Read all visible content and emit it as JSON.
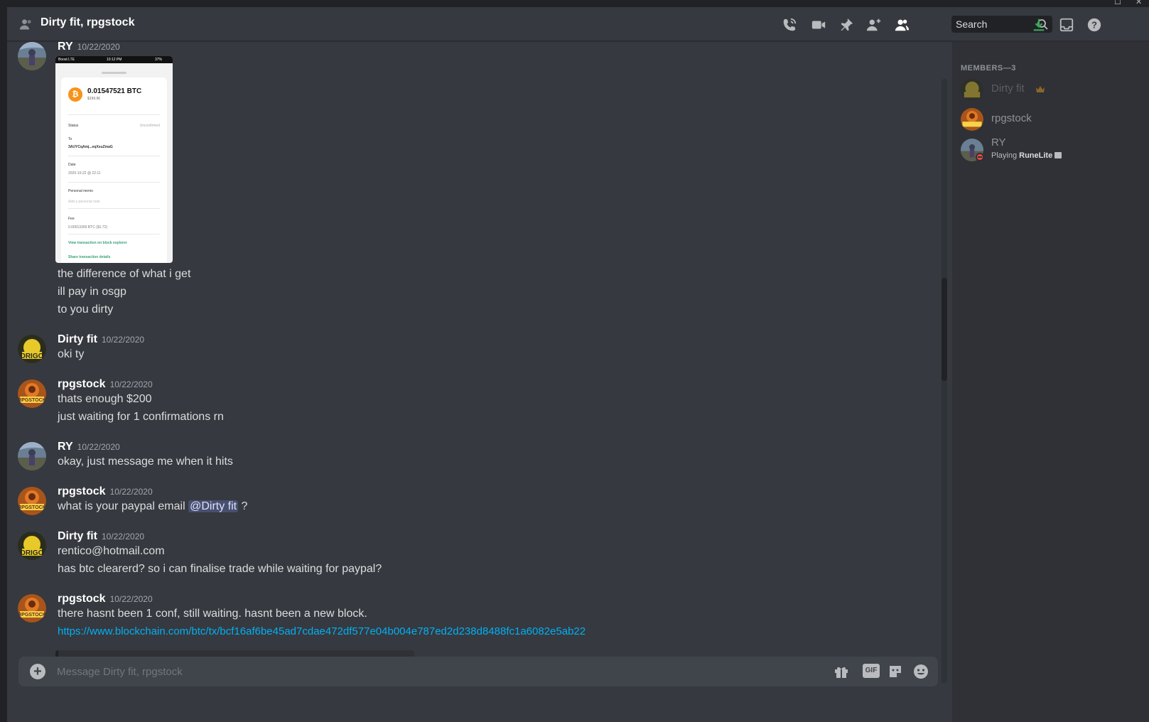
{
  "header": {
    "title": "Dirty fit, rpgstock",
    "search_placeholder": "Search"
  },
  "icons": {
    "dm": "dm-people-icon",
    "call": "phone-call-icon",
    "video": "video-camera-icon",
    "pin": "pin-icon",
    "add_friend": "add-member-icon",
    "members": "member-list-icon",
    "search": "search-icon",
    "download": "download-icon",
    "inbox": "inbox-icon",
    "help": "help-icon",
    "gift": "gift-icon",
    "sticker": "sticker-icon",
    "emoji": "emoji-icon",
    "crown": "crown-icon"
  },
  "colors": {
    "accent_green": "#3ba55c",
    "link": "#00b0f4",
    "mention_bg": "#414675",
    "dnd": "#f04747"
  },
  "receipt": {
    "carrier": "Boost  LTE",
    "time": "10:12 PM",
    "battery": "37%",
    "amount": "0.01547521 BTC",
    "usd": "$199.96",
    "status_label": "Status",
    "status_value": "Unconfirmed",
    "to_label": "To",
    "to_value": "3AUYCqAmj...eqXsuZmaG",
    "date_label": "Date",
    "date_value": "2020-10-22 @ 22:11",
    "memo_label": "Personal memo",
    "memo_placeholder": "Add a personal note",
    "fee_label": "Fee",
    "fee_value": "0.00013300 BTC ($1.72)",
    "link1": "View transaction on block explorer",
    "link2": "Share transaction details"
  },
  "messages": [
    {
      "author": "RY",
      "timestamp": "10/22/2020",
      "lines": [
        "the difference of what i get",
        "ill pay in osgp",
        "to you dirty"
      ]
    },
    {
      "author": "Dirty fit",
      "timestamp": "10/22/2020",
      "lines": [
        "oki ty"
      ]
    },
    {
      "author": "rpgstock",
      "timestamp": "10/22/2020",
      "lines": [
        "thats enough $200",
        "just waiting for 1 confirmations rn"
      ]
    },
    {
      "author": "RY",
      "timestamp": "10/22/2020",
      "lines": [
        "okay, just message me when it hits"
      ]
    },
    {
      "author": "rpgstock",
      "timestamp": "10/22/2020",
      "line_pre": "what is your paypal email ",
      "mention": "@Dirty fit",
      "line_post": " ?"
    },
    {
      "author": "Dirty fit",
      "timestamp": "10/22/2020",
      "lines": [
        "rentico@hotmail.com",
        "has btc clearerd? so i can finalise trade while waiting for paypal?"
      ]
    },
    {
      "author": "rpgstock",
      "timestamp": "10/22/2020",
      "lines": [
        "there hasnt been 1 conf, still waiting. hasnt been a new block."
      ],
      "link": "https://www.blockchain.com/btc/tx/bcf16af6be45ad7cdae472df577e04b004e787ed2d238d8488fc1a6082e5ab22"
    }
  ],
  "composer": {
    "placeholder": "Message Dirty fit, rpgstock",
    "gif_label": "GIF"
  },
  "members": {
    "header": "MEMBERS—3",
    "list": [
      {
        "name": "Dirty fit",
        "owner": true
      },
      {
        "name": "rpgstock"
      },
      {
        "name": "RY",
        "activity_prefix": "Playing ",
        "activity": "RuneLite"
      }
    ]
  }
}
